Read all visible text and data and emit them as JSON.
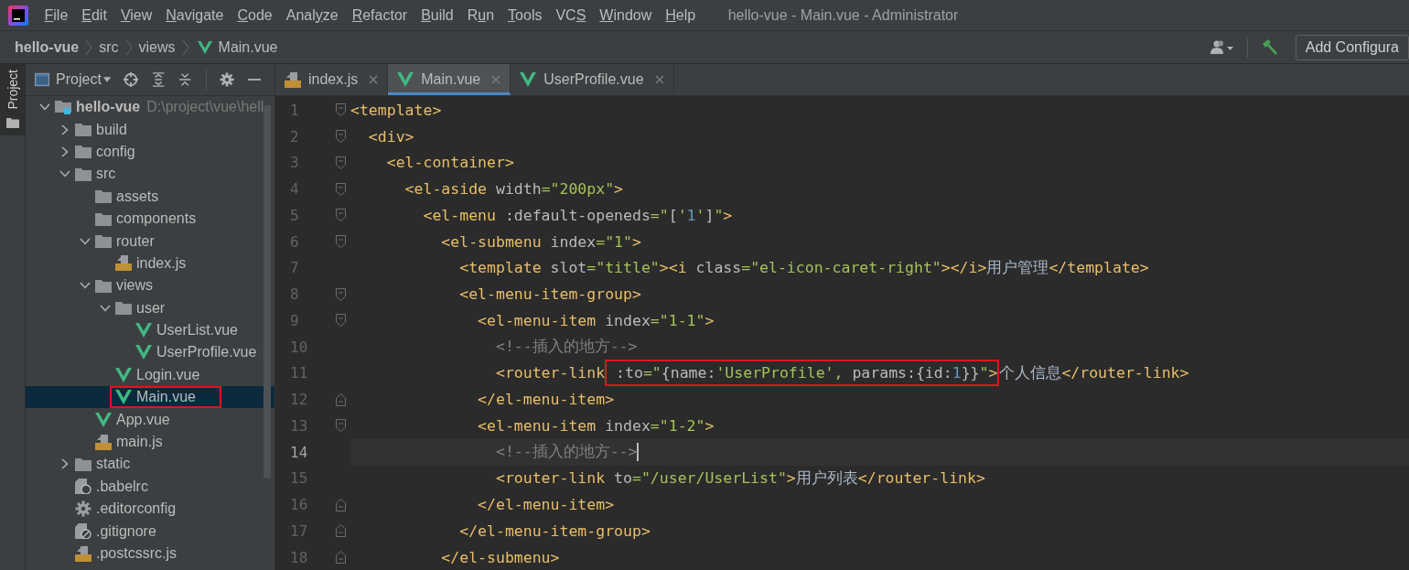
{
  "window": {
    "title": "hello-vue - Main.vue - Administrator"
  },
  "menu": [
    {
      "key": "F",
      "after": "ile"
    },
    {
      "key": "E",
      "after": "dit"
    },
    {
      "key": "V",
      "after": "iew"
    },
    {
      "key": "N",
      "after": "avigate"
    },
    {
      "key": "C",
      "after": "ode"
    },
    {
      "before": "Anal",
      "key": "y",
      "after": "ze"
    },
    {
      "key": "R",
      "after": "efactor"
    },
    {
      "key": "B",
      "after": "uild"
    },
    {
      "before": "R",
      "key": "u",
      "after": "n"
    },
    {
      "key": "T",
      "after": "ools"
    },
    {
      "before": "VC",
      "key": "S"
    },
    {
      "key": "W",
      "after": "indow"
    },
    {
      "key": "H",
      "after": "elp"
    }
  ],
  "breadcrumb": [
    {
      "label": "hello-vue",
      "kind": "project"
    },
    {
      "label": "src",
      "kind": "folder"
    },
    {
      "label": "views",
      "kind": "folder"
    },
    {
      "label": "Main.vue",
      "kind": "vue"
    }
  ],
  "run_config": {
    "label": "Add Configura"
  },
  "tool_window": {
    "strip_label": "Project",
    "title": "Project"
  },
  "tree": [
    {
      "label": "hello-vue",
      "kind": "module",
      "hint": "D:\\project\\vue\\hell",
      "expanded": true,
      "selected": false,
      "children": [
        {
          "label": "build",
          "kind": "folder",
          "expanded": false,
          "selected": false
        },
        {
          "label": "config",
          "kind": "folder",
          "expanded": false,
          "selected": false
        },
        {
          "label": "src",
          "kind": "folder",
          "expanded": true,
          "selected": false,
          "children": [
            {
              "label": "assets",
              "kind": "folder",
              "selected": false
            },
            {
              "label": "components",
              "kind": "folder",
              "selected": false
            },
            {
              "label": "router",
              "kind": "folder",
              "expanded": true,
              "selected": false,
              "children": [
                {
                  "label": "index.js",
                  "kind": "js",
                  "selected": false
                }
              ]
            },
            {
              "label": "views",
              "kind": "folder",
              "expanded": true,
              "selected": false,
              "children": [
                {
                  "label": "user",
                  "kind": "folder",
                  "expanded": true,
                  "selected": false,
                  "children": [
                    {
                      "label": "UserList.vue",
                      "kind": "vue",
                      "selected": false
                    },
                    {
                      "label": "UserProfile.vue",
                      "kind": "vue",
                      "selected": false
                    }
                  ]
                },
                {
                  "label": "Login.vue",
                  "kind": "vue",
                  "selected": false
                },
                {
                  "label": "Main.vue",
                  "kind": "vue",
                  "selected": true,
                  "boxed": true
                }
              ]
            },
            {
              "label": "App.vue",
              "kind": "vue",
              "selected": false
            },
            {
              "label": "main.js",
              "kind": "js",
              "selected": false
            }
          ]
        },
        {
          "label": "static",
          "kind": "folder",
          "expanded": false,
          "selected": false
        },
        {
          "label": ".babelrc",
          "kind": "json",
          "selected": false
        },
        {
          "label": ".editorconfig",
          "kind": "config",
          "selected": false
        },
        {
          "label": ".gitignore",
          "kind": "ignore",
          "selected": false
        },
        {
          "label": ".postcssrc.js",
          "kind": "js",
          "selected": false
        }
      ]
    }
  ],
  "tabs": [
    {
      "label": "index.js",
      "kind": "js",
      "selected": false
    },
    {
      "label": "Main.vue",
      "kind": "vue",
      "selected": true
    },
    {
      "label": "UserProfile.vue",
      "kind": "vue",
      "selected": false
    }
  ],
  "code": [
    {
      "number": "1",
      "kind": "opening",
      "tokens": [
        {
          "kind": "tag",
          "text": "<template>"
        }
      ]
    },
    {
      "number": "2",
      "kind": "opening",
      "tokens": [
        {
          "kind": "tag",
          "text": "  <div>"
        }
      ]
    },
    {
      "number": "3",
      "kind": "opening",
      "tokens": [
        {
          "kind": "tag",
          "text": "    <el-container>"
        }
      ]
    },
    {
      "number": "4",
      "kind": "opening",
      "tokens": [
        {
          "kind": "tag",
          "text": "      <el-aside"
        },
        {
          "kind": "attr",
          "text": " width"
        },
        {
          "kind": "str",
          "text": "=\"200px\""
        },
        {
          "kind": "tag",
          "text": ">"
        }
      ]
    },
    {
      "number": "5",
      "kind": "opening",
      "tokens": [
        {
          "kind": "tag",
          "text": "        <el-menu"
        },
        {
          "kind": "attr",
          "text": " :default-openeds"
        },
        {
          "kind": "str",
          "text": "=\""
        },
        {
          "kind": "attr",
          "text": "["
        },
        {
          "kind": "str",
          "text": "'"
        },
        {
          "kind": "num",
          "text": "1"
        },
        {
          "kind": "str",
          "text": "'"
        },
        {
          "kind": "attr",
          "text": "]"
        },
        {
          "kind": "str",
          "text": "\""
        },
        {
          "kind": "tag",
          "text": ">"
        }
      ]
    },
    {
      "number": "6",
      "kind": "opening",
      "tokens": [
        {
          "kind": "tag",
          "text": "          <el-submenu"
        },
        {
          "kind": "attr",
          "text": " index"
        },
        {
          "kind": "str",
          "text": "=\"1\""
        },
        {
          "kind": "tag",
          "text": ">"
        }
      ]
    },
    {
      "number": "7",
      "kind": "plain",
      "tokens": [
        {
          "kind": "tag",
          "text": "            <template"
        },
        {
          "kind": "attr",
          "text": " slot"
        },
        {
          "kind": "str",
          "text": "=\"title\""
        },
        {
          "kind": "tag",
          "text": "><i"
        },
        {
          "kind": "attr",
          "text": " class"
        },
        {
          "kind": "str",
          "text": "=\"el-icon-caret-right\""
        },
        {
          "kind": "tag",
          "text": "></i>"
        },
        {
          "kind": "text",
          "text": "用户管理"
        },
        {
          "kind": "tag",
          "text": "</template>"
        }
      ]
    },
    {
      "number": "8",
      "kind": "opening",
      "tokens": [
        {
          "kind": "tag",
          "text": "            <el-menu-item-group>"
        }
      ]
    },
    {
      "number": "9",
      "kind": "opening",
      "tokens": [
        {
          "kind": "tag",
          "text": "              <el-menu-item"
        },
        {
          "kind": "attr",
          "text": " index"
        },
        {
          "kind": "str",
          "text": "=\"1-1\""
        },
        {
          "kind": "tag",
          "text": ">"
        }
      ]
    },
    {
      "number": "10",
      "kind": "plain",
      "tokens": [
        {
          "kind": "comment",
          "text": "                <!--插入的地方-->"
        }
      ]
    },
    {
      "number": "11",
      "kind": "plain",
      "tokens": [
        {
          "kind": "tag",
          "text": "                <router-link"
        },
        {
          "kind": "group",
          "boxed": true,
          "tokens": [
            {
              "kind": "attr",
              "text": " :to"
            },
            {
              "kind": "str",
              "text": "=\""
            },
            {
              "kind": "attr",
              "text": "{name:"
            },
            {
              "kind": "str",
              "text": "'UserProfile',"
            },
            {
              "kind": "attr",
              "text": " params:{id:"
            },
            {
              "kind": "num",
              "text": "1"
            },
            {
              "kind": "attr",
              "text": "}}"
            },
            {
              "kind": "str",
              "text": "\""
            },
            {
              "kind": "tag",
              "text": ">"
            }
          ]
        },
        {
          "kind": "text",
          "text": "个人信息"
        },
        {
          "kind": "tag",
          "text": "</router-link>"
        }
      ]
    },
    {
      "number": "12",
      "kind": "closing",
      "tokens": [
        {
          "kind": "tag",
          "text": "              </el-menu-item>"
        }
      ]
    },
    {
      "number": "13",
      "kind": "opening",
      "tokens": [
        {
          "kind": "tag",
          "text": "              <el-menu-item"
        },
        {
          "kind": "attr",
          "text": " index"
        },
        {
          "kind": "str",
          "text": "=\"1-2\""
        },
        {
          "kind": "tag",
          "text": ">"
        }
      ]
    },
    {
      "number": "14",
      "kind": "plain",
      "current": true,
      "tokens": [
        {
          "kind": "comment",
          "text": "                <!--插入的地方-->"
        }
      ]
    },
    {
      "number": "15",
      "kind": "plain",
      "tokens": [
        {
          "kind": "tag",
          "text": "                <router-link"
        },
        {
          "kind": "attr",
          "text": " to"
        },
        {
          "kind": "str",
          "text": "=\"/user/UserList\""
        },
        {
          "kind": "tag",
          "text": ">"
        },
        {
          "kind": "text",
          "text": "用户列表"
        },
        {
          "kind": "tag",
          "text": "</router-link>"
        }
      ]
    },
    {
      "number": "16",
      "kind": "closing",
      "tokens": [
        {
          "kind": "tag",
          "text": "              </el-menu-item>"
        }
      ]
    },
    {
      "number": "17",
      "kind": "closing",
      "tokens": [
        {
          "kind": "tag",
          "text": "            </el-menu-item-group>"
        }
      ]
    },
    {
      "number": "18",
      "kind": "closing",
      "tokens": [
        {
          "kind": "tag",
          "text": "          </el-submenu>"
        }
      ]
    }
  ]
}
